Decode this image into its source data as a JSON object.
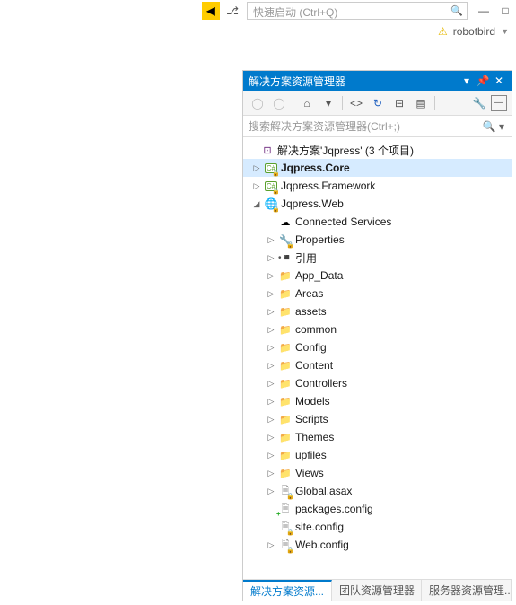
{
  "topbar": {
    "quick_launch_placeholder": "快速启动 (Ctrl+Q)"
  },
  "user": {
    "name": "robotbird"
  },
  "panel": {
    "title": "解决方案资源管理器",
    "search_placeholder": "搜索解决方案资源管理器(Ctrl+;)"
  },
  "tree": {
    "solution": "解决方案'Jqpress' (3 个项目)",
    "proj_core": "Jqpress.Core",
    "proj_framework": "Jqpress.Framework",
    "proj_web": "Jqpress.Web",
    "connected_services": "Connected Services",
    "properties": "Properties",
    "references": "引用",
    "folders": [
      "App_Data",
      "Areas",
      "assets",
      "common",
      "Config",
      "Content",
      "Controllers",
      "Models",
      "Scripts",
      "Themes",
      "upfiles",
      "Views"
    ],
    "global_asax": "Global.asax",
    "packages_config": "packages.config",
    "site_config": "site.config",
    "web_config": "Web.config"
  },
  "tabs": {
    "t1": "解决方案资源...",
    "t2": "团队资源管理器",
    "t3": "服务器资源管理..."
  }
}
